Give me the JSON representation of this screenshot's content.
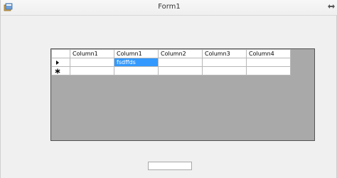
{
  "window": {
    "title": "Form1"
  },
  "grid": {
    "columns": [
      "Column1",
      "Column1",
      "Column2",
      "Column3",
      "Column4"
    ],
    "rows": [
      {
        "indicator": "current-row-arrow-icon",
        "cells": [
          "",
          "fsdffds",
          "",
          "",
          ""
        ]
      },
      {
        "indicator": "new-row-asterisk-icon",
        "cells": [
          "",
          "",
          "",
          "",
          ""
        ]
      }
    ],
    "selected_cell": {
      "row": 0,
      "column": 1
    }
  },
  "textbox": {
    "value": ""
  },
  "colors": {
    "window_bg": "#f0f0f0",
    "grid_bg": "#a9a9a9",
    "selection": "#3399ff"
  }
}
